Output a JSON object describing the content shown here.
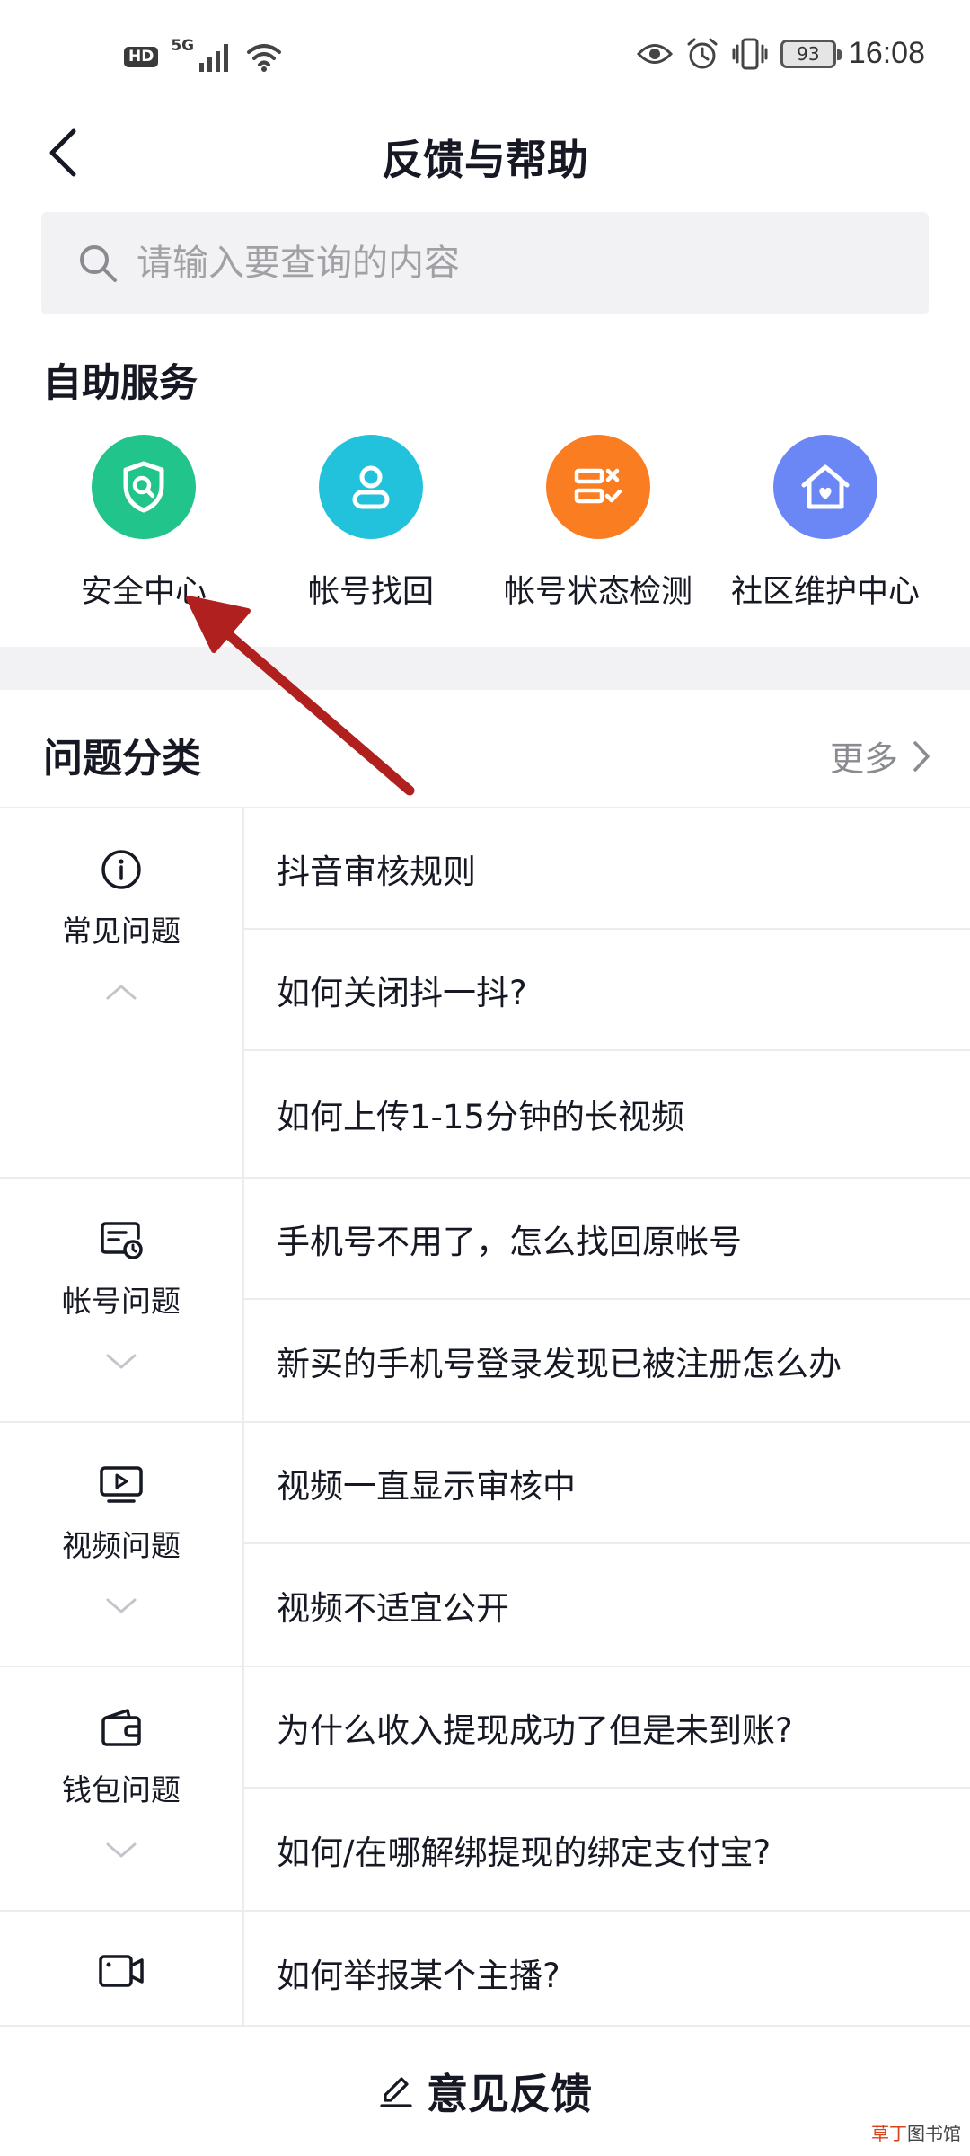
{
  "status_bar": {
    "hd": "HD",
    "network": "5G",
    "battery": "93",
    "time": "16:08"
  },
  "header": {
    "title": "反馈与帮助"
  },
  "search": {
    "placeholder": "请输入要查询的内容"
  },
  "self_service": {
    "title": "自助服务",
    "items": [
      {
        "label": "安全中心",
        "icon": "shield-search-icon",
        "color": "#21c48a"
      },
      {
        "label": "帐号找回",
        "icon": "user-icon",
        "color": "#22c2dc"
      },
      {
        "label": "帐号状态检测",
        "icon": "checklist-icon",
        "color": "#fa7d22"
      },
      {
        "label": "社区维护中心",
        "icon": "home-heart-icon",
        "color": "#6a87f5"
      }
    ]
  },
  "categories": {
    "title": "问题分类",
    "more": "更多",
    "groups": [
      {
        "label": "常见问题",
        "icon": "info-icon",
        "expanded": true,
        "questions": [
          "抖音审核规则",
          "如何关闭抖一抖?",
          "如何上传1-15分钟的长视频"
        ]
      },
      {
        "label": "帐号问题",
        "icon": "account-card-icon",
        "expanded": false,
        "questions": [
          "手机号不用了，怎么找回原帐号",
          "新买的手机号登录发现已被注册怎么办"
        ]
      },
      {
        "label": "视频问题",
        "icon": "video-play-icon",
        "expanded": false,
        "questions": [
          "视频一直显示审核中",
          "视频不适宜公开"
        ]
      },
      {
        "label": "钱包问题",
        "icon": "wallet-icon",
        "expanded": false,
        "questions": [
          "为什么收入提现成功了但是未到账?",
          "如何/在哪解绑提现的绑定支付宝?"
        ]
      },
      {
        "label": "",
        "icon": "live-camera-icon",
        "expanded": false,
        "questions": [
          "如何举报某个主播?"
        ]
      }
    ]
  },
  "footer": {
    "label": "意见反馈"
  },
  "watermark": {
    "accent": "草丁",
    "rest": "图书馆"
  },
  "colors": {
    "annotation_arrow": "#b0201e",
    "text_primary": "#161823",
    "text_secondary": "#8a8b91"
  }
}
